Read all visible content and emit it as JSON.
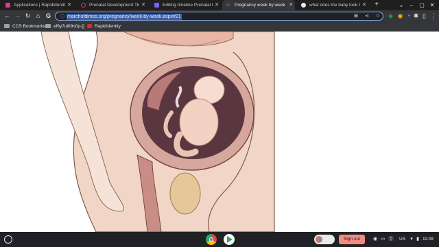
{
  "tabs": [
    {
      "title": "Applications | RapidIdentity",
      "favicon_color": "#d93e8f",
      "active": false
    },
    {
      "title": "Prenatal Development Timeline",
      "favicon_color": "#e53935",
      "active": false
    },
    {
      "title": "Editing timeline Prenatal Development",
      "favicon_color": "#7b61ff",
      "active": false
    },
    {
      "title": "Pregnancy week by week",
      "favicon_color": "#7e57c2",
      "active": true
    },
    {
      "title": "what does the baby look like",
      "favicon_color": "#e8eaed",
      "active": false
    }
  ],
  "window": {
    "new_tab": "+",
    "minimize": "–",
    "maximize": "▢",
    "close": "✕"
  },
  "toolbar": {
    "back": "←",
    "forward": "→",
    "reload": "↻",
    "home": "⌂",
    "g": "G"
  },
  "omnibox": {
    "url": "marchofdimes.org/pregnancy/week-by-week.aspx#21",
    "lock": "ⓘ"
  },
  "omnibox_actions": {
    "install": "⊞",
    "share": "⋖",
    "bookmark": "☆"
  },
  "extensions": {
    "ext1": "◈",
    "ext2": "◉",
    "ext3": "◔",
    "puzzle": "✱",
    "sidepanel": "▯",
    "menu": "⋮"
  },
  "bookmarks": [
    {
      "label": "CCS Bookmarks"
    },
    {
      "label": "ef6y7u8i9o0p-[]"
    },
    {
      "label": "RapidIdentity"
    }
  ],
  "shelf": {
    "sign_out": "Sign out",
    "tray_icons": [
      "◉",
      "▭",
      "⓪"
    ],
    "locale": "US",
    "time": "11:09"
  }
}
